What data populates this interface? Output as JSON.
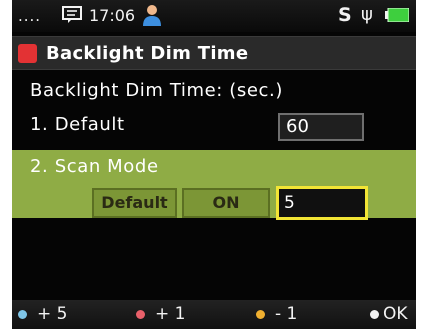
{
  "status_bar": {
    "dots": "....",
    "time": "17:06",
    "s_label": "S",
    "usb_glyph": "ψ",
    "icons": [
      "message-icon",
      "user-icon",
      "usb-icon",
      "battery-icon"
    ]
  },
  "title_bar": {
    "title": "Backlight Dim Time",
    "icon_color": "#e33234"
  },
  "content": {
    "heading": "Backlight Dim Time: (sec.)",
    "default_label": "1. Default",
    "default_value": "60",
    "scan_mode_label": "2. Scan Mode",
    "scan_options": {
      "default_label": "Default",
      "on_label": "ON"
    },
    "scan_value": "5",
    "highlight_color": "#8fac45",
    "focus_color": "#f2e535"
  },
  "footer": {
    "keys": [
      {
        "label": "+ 5",
        "color": "#7fc6e8"
      },
      {
        "label": "+ 1",
        "color": "#e8606a"
      },
      {
        "label": "- 1",
        "color": "#f0b030"
      },
      {
        "label": "OK",
        "color": "#f2f2f2"
      }
    ]
  }
}
